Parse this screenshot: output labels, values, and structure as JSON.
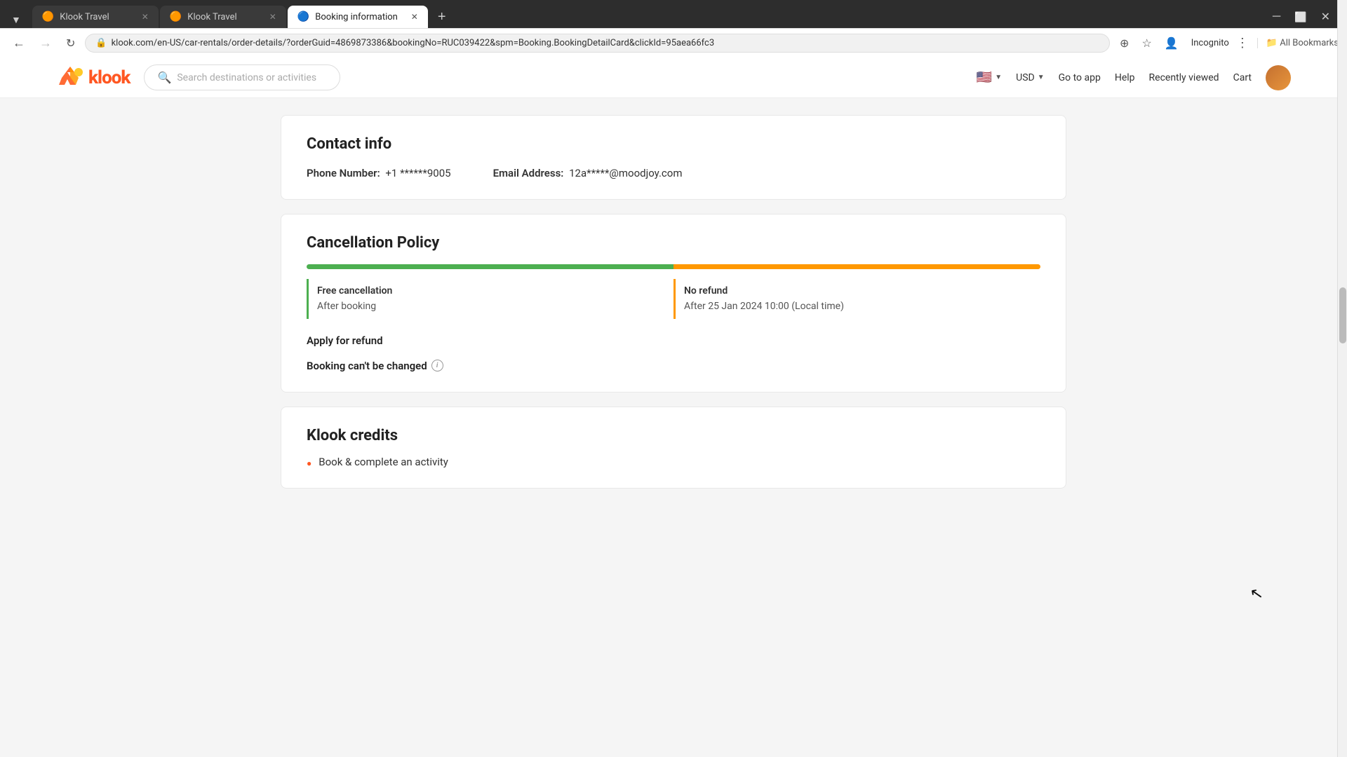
{
  "browser": {
    "tabs": [
      {
        "id": "tab1",
        "title": "Klook Travel",
        "favicon": "🟠",
        "active": false
      },
      {
        "id": "tab2",
        "title": "Klook Travel",
        "favicon": "🟠",
        "active": false
      },
      {
        "id": "tab3",
        "title": "Booking information",
        "favicon": "🔵",
        "active": true
      }
    ],
    "url": "klook.com/en-US/car-rentals/order-details/?orderGuid=4869873386&bookingNo=RUC039422&spm=Booking.BookingDetailCard&clickId=95aea66fc3",
    "incognito_label": "Incognito",
    "bookmarks_label": "All Bookmarks"
  },
  "nav": {
    "logo_text": "klook",
    "search_placeholder": "Search destinations or activities",
    "currency": "USD",
    "links": [
      "Go to app",
      "Help",
      "Recently viewed",
      "Cart"
    ],
    "currency_dropdown_label": "USD"
  },
  "contact_info": {
    "section_title": "Contact info",
    "phone_label": "Phone Number:",
    "phone_value": "+1 ******9005",
    "email_label": "Email Address:",
    "email_value": "12a*****@moodjoy.com"
  },
  "cancellation_policy": {
    "section_title": "Cancellation Policy",
    "free_title": "Free cancellation",
    "free_sub": "After booking",
    "no_refund_title": "No refund",
    "no_refund_sub": "After 25 Jan 2024 10:00 (Local time)",
    "apply_refund_label": "Apply for refund",
    "booking_change_label": "Booking can't be changed",
    "info_tooltip": "ℹ"
  },
  "klook_credits": {
    "section_title": "Klook credits",
    "item1": "Book & complete an activity"
  },
  "cursor": {
    "symbol": "↖"
  }
}
